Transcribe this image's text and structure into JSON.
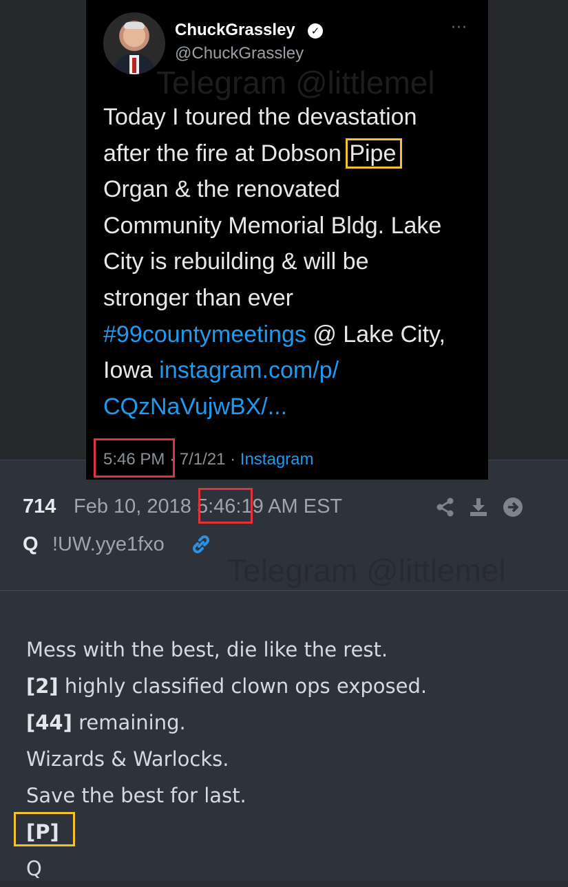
{
  "tweet": {
    "name": "ChuckGrassley",
    "verified_icon": "verified-badge-icon",
    "handle": "@ChuckGrassley",
    "more": "···",
    "watermark": "Telegram @littlemel",
    "text_lines": [
      "Today I toured the devastation",
      "after the fire at Dobson ",
      "Pipe",
      "Organ & the renovated",
      "Community Memorial Bldg. Lake",
      "City is rebuilding & will be",
      "stronger than ever",
      "#99countymeetings",
      " @ Lake City,",
      "Iowa ",
      "instagram.com/p/",
      "CQzNaVujwBX/..."
    ],
    "time": "5:46 PM",
    "date_sep": " · 7/1/21 · ",
    "source": "Instagram"
  },
  "post": {
    "number": "714",
    "date": "Feb 10, 2018 5:46:19 AM EST",
    "author": "Q",
    "tripcode": "!UW.yye1fxo",
    "watermark": "Telegram @littlemel",
    "lines": [
      {
        "bold": "",
        "text": "Mess with the best, die like the rest."
      },
      {
        "bold": "[2]",
        "text": " highly classified clown ops exposed."
      },
      {
        "bold": "[44]",
        "text": " remaining."
      },
      {
        "bold": "",
        "text": "Wizards & Warlocks."
      },
      {
        "bold": "",
        "text": "Save the best for last."
      },
      {
        "bold": "[P]",
        "text": ""
      },
      {
        "bold": "",
        "text": "Q"
      }
    ]
  },
  "colors": {
    "highlight_red": "#e0333a",
    "highlight_yellow": "#f2c232",
    "twitter_blue": "#1d9bf0"
  }
}
